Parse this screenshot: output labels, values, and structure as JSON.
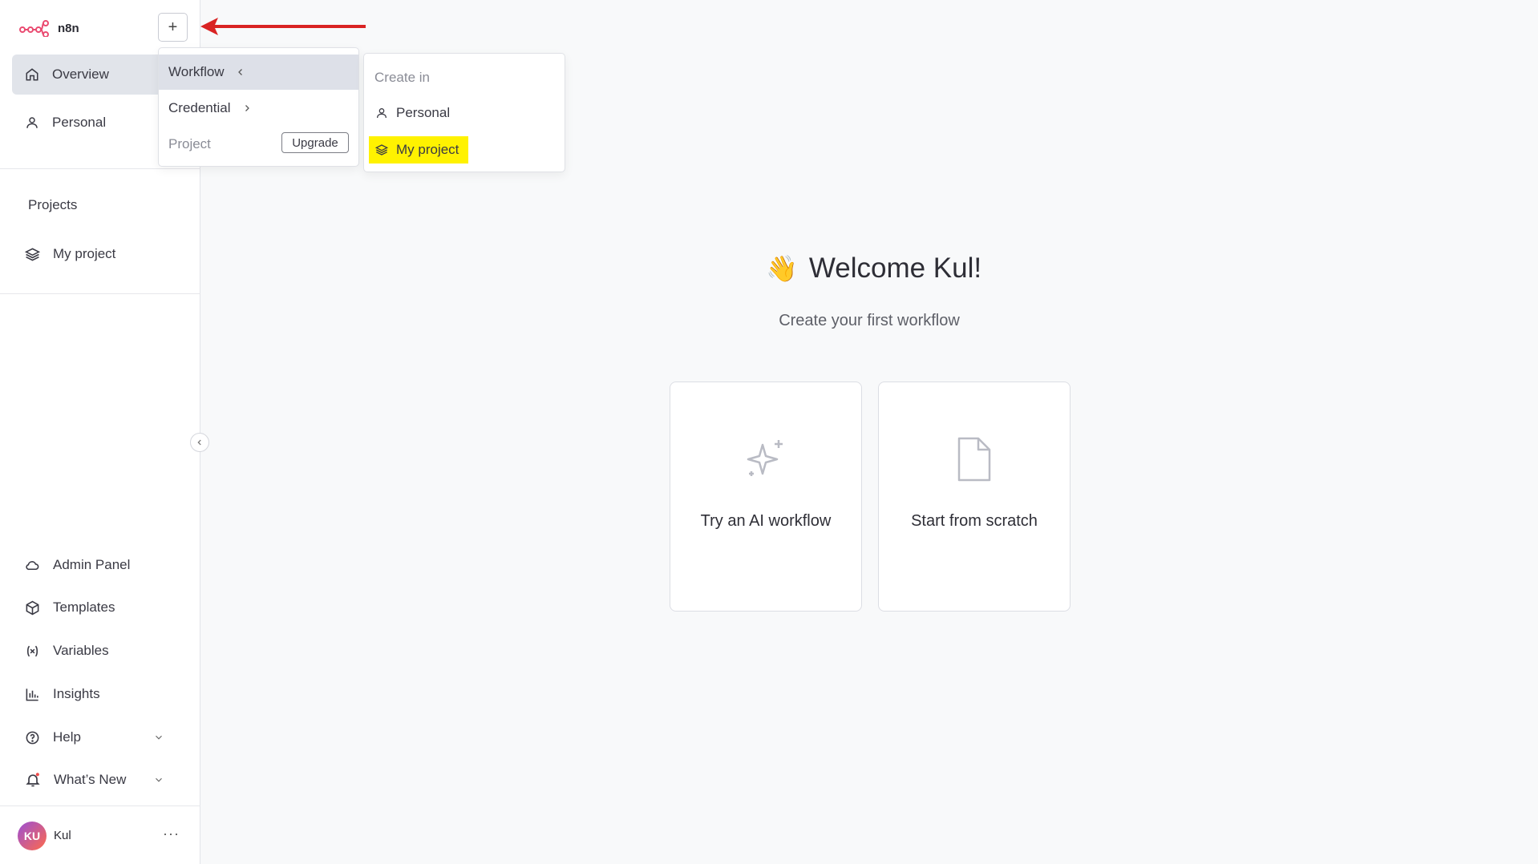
{
  "app": {
    "name": "n8n",
    "brand_color": "#ea4b71",
    "highlight_color": "#fff200",
    "annotation_color": "#d92323"
  },
  "sidebar": {
    "top_items": [
      {
        "label": "Overview",
        "icon": "home-icon",
        "active": true
      },
      {
        "label": "Personal",
        "icon": "user-icon",
        "active": false
      }
    ],
    "projects_title": "Projects",
    "projects": [
      {
        "label": "My project",
        "icon": "layers-icon"
      }
    ],
    "bottom_items": [
      {
        "label": "Admin Panel",
        "icon": "cloud-icon"
      },
      {
        "label": "Templates",
        "icon": "box-icon"
      },
      {
        "label": "Variables",
        "icon": "variable-icon"
      },
      {
        "label": "Insights",
        "icon": "bar-chart-icon"
      },
      {
        "label": "Help",
        "icon": "help-icon"
      },
      {
        "label": "What’s New",
        "icon": "bell-icon"
      }
    ],
    "user": {
      "initials": "KU",
      "name": "Kul",
      "more": "···"
    }
  },
  "create_menu": {
    "items": [
      {
        "label": "Workflow"
      },
      {
        "label": "Credential"
      },
      {
        "label": "Project",
        "button": "Upgrade"
      }
    ]
  },
  "create_in_menu": {
    "title": "Create in",
    "items": [
      {
        "label": "Personal",
        "icon": "user-icon"
      },
      {
        "label": "My project",
        "icon": "layers-icon",
        "highlighted": true
      }
    ]
  },
  "main": {
    "welcome": "Welcome Kul!",
    "wave_emoji": "👋",
    "subtitle": "Create your first workflow",
    "cards": [
      {
        "label": "Try an AI workflow",
        "icon": "sparkle-icon"
      },
      {
        "label": "Start from scratch",
        "icon": "file-icon"
      }
    ]
  }
}
